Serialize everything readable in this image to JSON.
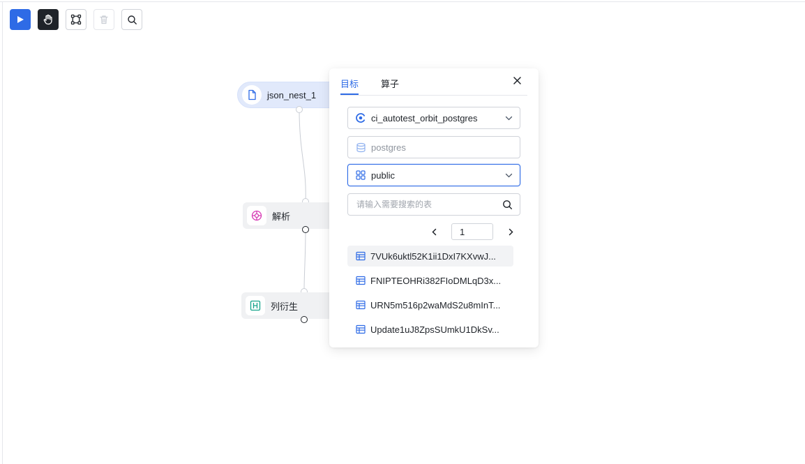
{
  "toolbar": {
    "buttons": [
      {
        "name": "run",
        "icon": "play-icon"
      },
      {
        "name": "pan",
        "icon": "hand-icon"
      },
      {
        "name": "select",
        "icon": "node-select-icon"
      },
      {
        "name": "delete",
        "icon": "trash-icon"
      },
      {
        "name": "search",
        "icon": "search-icon"
      }
    ]
  },
  "canvas": {
    "nodes": [
      {
        "label": "json_nest_1",
        "icon": "file-icon"
      },
      {
        "label": "解析",
        "icon": "parse-icon"
      },
      {
        "label": "列衍生",
        "icon": "column-derive-icon"
      }
    ]
  },
  "panel": {
    "tabs": [
      "目标",
      "算子"
    ],
    "active_tab": "目标",
    "datasource": {
      "value": "ci_autotest_orbit_postgres",
      "icon": "postgres-icon"
    },
    "database": {
      "value": "postgres",
      "icon": "database-icon"
    },
    "schema": {
      "value": "public",
      "icon": "schema-icon"
    },
    "table_search": {
      "placeholder": "请输入需要搜索的表"
    },
    "pagination": {
      "page": "1"
    },
    "tables": [
      "7VUk6uktl52K1ii1DxI7KXvwJ...",
      "FNIPTEOHRi382FIoDMLqD3x...",
      "URN5m516p2waMdS2u8mInT...",
      "Update1uJ8ZpsSUmkU1DkSv..."
    ]
  },
  "colors": {
    "accent": "#2e6be6",
    "dark": "#1f2329",
    "node_selected_bg": "#e1e9fb",
    "node_bg": "#f0f1f3"
  }
}
